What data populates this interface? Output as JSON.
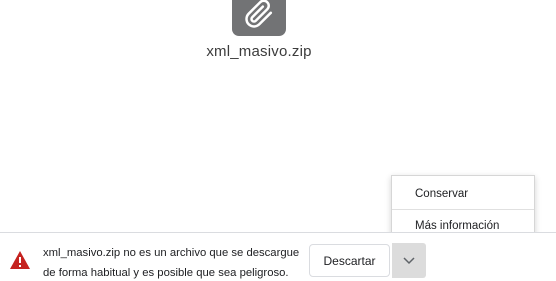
{
  "file": {
    "name": "xml_masivo.zip",
    "icon": "paperclip-icon"
  },
  "download_bar": {
    "warning_icon": "warning-triangle-icon",
    "warning_line1": "xml_masivo.zip no es un archivo que se descargue",
    "warning_line2": "de forma habitual y es posible que sea peligroso.",
    "discard_label": "Descartar",
    "dropdown_icon": "chevron-down-icon"
  },
  "menu": {
    "items": [
      {
        "label": "Conservar"
      },
      {
        "label": "Más información"
      }
    ]
  },
  "colors": {
    "tile": "#727375",
    "warning": "#c5221f",
    "dropdown_bg": "#dcdcdc"
  }
}
